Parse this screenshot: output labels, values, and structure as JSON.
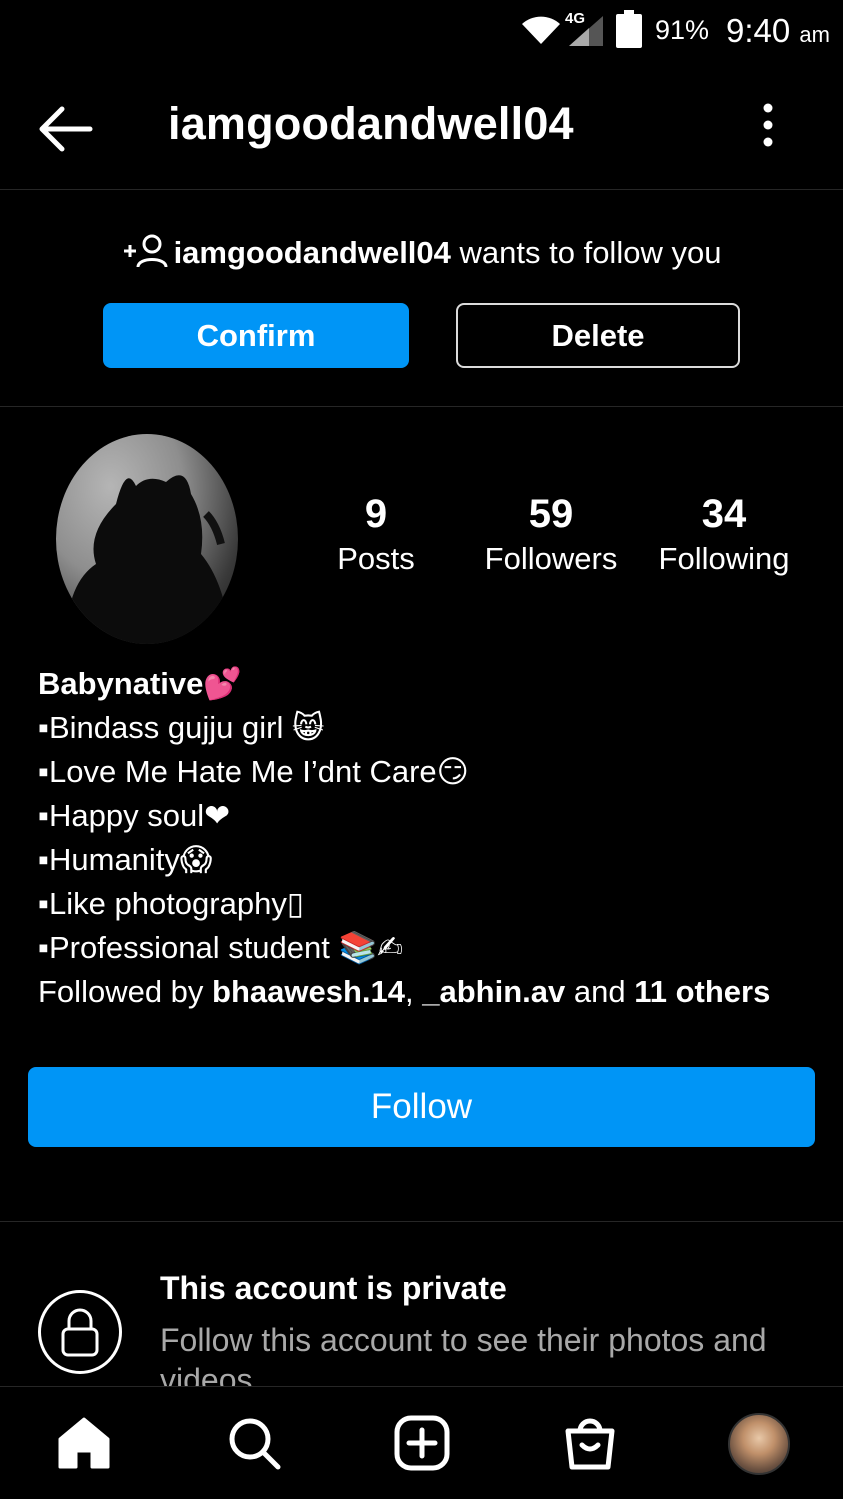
{
  "status_bar": {
    "network": "4G",
    "battery": "91%",
    "time": "9:40",
    "ampm": "am"
  },
  "header": {
    "title": "iamgoodandwell04"
  },
  "follow_request": {
    "username": "iamgoodandwell04",
    "message": " wants to follow you",
    "confirm_label": "Confirm",
    "delete_label": "Delete"
  },
  "stats": [
    {
      "value": "9",
      "label": "Posts"
    },
    {
      "value": "59",
      "label": "Followers"
    },
    {
      "value": "34",
      "label": "Following"
    }
  ],
  "bio": {
    "name": "Babynative💕",
    "lines": [
      "▪Bindass gujju girl 😸",
      "▪Love Me Hate Me I’dnt Care😏",
      "▪Happy soul❤",
      "▪Humanity😱",
      "▪Like photography▯",
      "▪Professional student 📚✍"
    ],
    "followed_by_prefix": "Followed by ",
    "followed_by_user1": "bhaawesh.14",
    "followed_by_sep": ", ",
    "followed_by_user2": "_abhin.av",
    "followed_by_and": " and ",
    "followed_by_others": "11 others"
  },
  "follow_button": "Follow",
  "private": {
    "title": "This account is private",
    "subtitle": "Follow this account to see their photos and videos."
  },
  "colors": {
    "accent": "#0095f6",
    "background": "#000000",
    "muted_text": "#a8a8a8"
  }
}
